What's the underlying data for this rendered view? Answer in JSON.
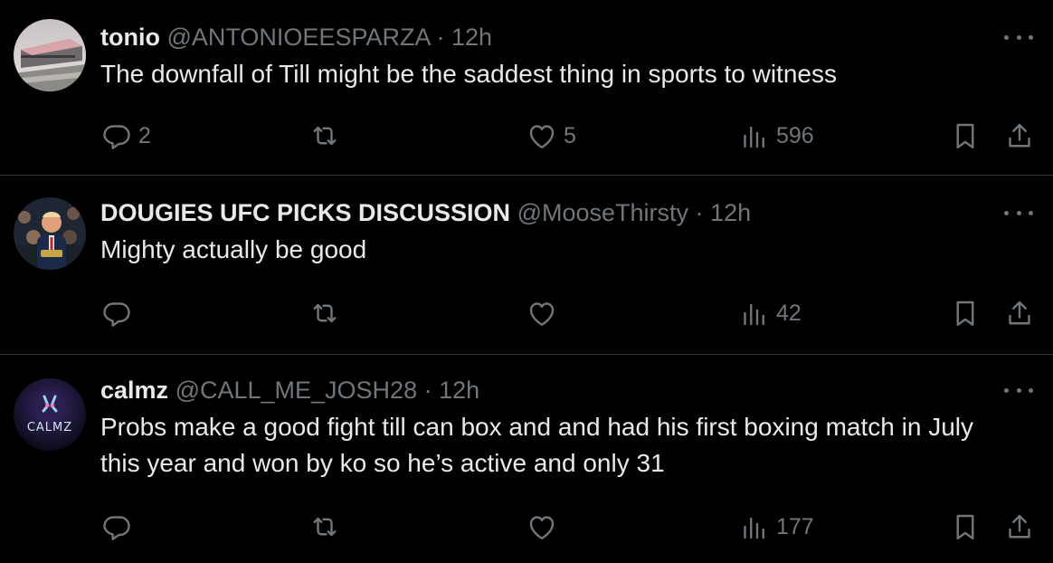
{
  "colors": {
    "background": "#000000",
    "primary_text": "#e7e9ea",
    "secondary_text": "#71767b",
    "divider": "#2f3336"
  },
  "tweets": [
    {
      "display_name": "tonio",
      "handle": "@ANTONIOEESPARZA",
      "separator": "·",
      "time": "12h",
      "text": "The downfall of Till might be the saddest thing in sports to witness",
      "replies": "2",
      "retweets": "",
      "likes": "5",
      "views": "596",
      "avatar_icon": "building-photo-avatar"
    },
    {
      "display_name": "DOUGIES UFC PICKS DISCUSSION",
      "handle": "@MooseThirsty",
      "separator": "·",
      "time": "12h",
      "text": "Mighty actually be good",
      "replies": "",
      "retweets": "",
      "likes": "",
      "views": "42",
      "avatar_icon": "crowd-photo-avatar"
    },
    {
      "display_name": "calmz",
      "handle": "@CALL_ME_JOSH28",
      "separator": "·",
      "time": "12h",
      "text": "Probs make a good fight till can box and and had his first boxing match in July this year and won by ko so he’s active and only 31",
      "replies": "",
      "retweets": "",
      "likes": "",
      "views": "177",
      "avatar_icon": "calmz-logo-avatar",
      "avatar_label": "CALMZ"
    }
  ]
}
